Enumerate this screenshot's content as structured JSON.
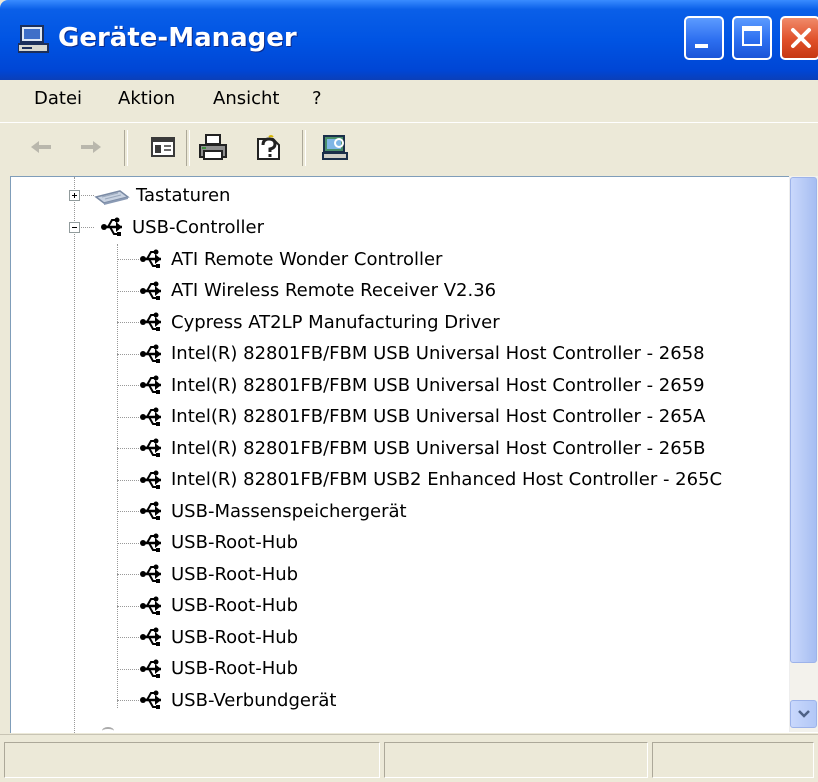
{
  "window": {
    "title": "Geräte-Manager"
  },
  "menu": {
    "items": [
      "Datei",
      "Aktion",
      "Ansicht",
      "?"
    ]
  },
  "toolbar": {
    "icons": [
      "back-arrow-icon",
      "forward-arrow-icon",
      "properties-panel-icon",
      "printer-icon",
      "help-icon",
      "computer-scan-icon"
    ]
  },
  "tree": {
    "keyboards": {
      "label": "Tastaturen",
      "expanded": false
    },
    "usb_controller": {
      "label": "USB-Controller",
      "expanded": true,
      "children": [
        "ATI Remote Wonder Controller",
        "ATI Wireless Remote Receiver V2.36",
        "Cypress AT2LP Manufacturing Driver",
        "Intel(R) 82801FB/FBM USB Universal Host Controller - 2658",
        "Intel(R) 82801FB/FBM USB Universal Host Controller - 2659",
        "Intel(R) 82801FB/FBM USB Universal Host Controller - 265A",
        "Intel(R) 82801FB/FBM USB Universal Host Controller - 265B",
        "Intel(R) 82801FB/FBM USB2 Enhanced Host Controller - 265C",
        "USB-Massenspeichergerät",
        "USB-Root-Hub",
        "USB-Root-Hub",
        "USB-Root-Hub",
        "USB-Root-Hub",
        "USB-Root-Hub",
        "USB-Verbundgerät"
      ]
    }
  },
  "colors": {
    "titlebar": "#0054e3",
    "close_button": "#e0502a",
    "window_bg": "#ece9d8"
  }
}
